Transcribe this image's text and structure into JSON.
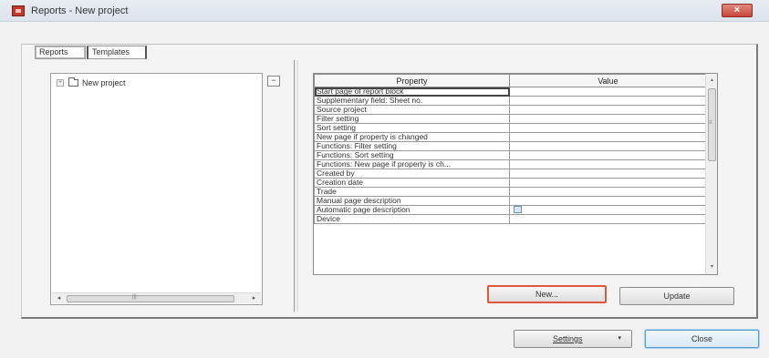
{
  "window": {
    "title": "Reports - New project",
    "close_glyph": "×"
  },
  "tabs": [
    {
      "label": "Reports"
    },
    {
      "label": "Templates"
    }
  ],
  "tree": {
    "expander": "+",
    "root_label": "New project",
    "scroll_left": "◂",
    "scroll_right": "▸",
    "scroll_grip": "|||"
  },
  "collapse_button": "−",
  "grid": {
    "columns": [
      "Property",
      "Value"
    ],
    "rows": [
      {
        "property": "Start page of report block",
        "value": "",
        "checkbox": false
      },
      {
        "property": "Supplementary field: Sheet no.",
        "value": "",
        "checkbox": false
      },
      {
        "property": "Source project",
        "value": "",
        "checkbox": false
      },
      {
        "property": "Filter setting",
        "value": "",
        "checkbox": false
      },
      {
        "property": "Sort setting",
        "value": "",
        "checkbox": false
      },
      {
        "property": "New page if property is changed",
        "value": "",
        "checkbox": false
      },
      {
        "property": "Functions: Filter setting",
        "value": "",
        "checkbox": false
      },
      {
        "property": "Functions: Sort setting",
        "value": "",
        "checkbox": false
      },
      {
        "property": "Functions: New page if property is ch...",
        "value": "",
        "checkbox": false
      },
      {
        "property": "Created by",
        "value": "",
        "checkbox": false
      },
      {
        "property": "Creation date",
        "value": "",
        "checkbox": false
      },
      {
        "property": "Trade",
        "value": "",
        "checkbox": false
      },
      {
        "property": "Manual page description",
        "value": "",
        "checkbox": false
      },
      {
        "property": "Automatic page description",
        "value": "",
        "checkbox": true
      },
      {
        "property": "Device",
        "value": "",
        "checkbox": false
      }
    ],
    "scroll_up": "▴",
    "scroll_down": "▾",
    "scroll_grip": "≡"
  },
  "buttons": {
    "new": "New...",
    "update": "Update",
    "settings": "Settings",
    "settings_dropdown": "▾",
    "close": "Close"
  },
  "colors": {
    "highlight_border": "#e0563f",
    "default_button_border": "#5a9ccc",
    "title_icon": "#c0392b"
  }
}
